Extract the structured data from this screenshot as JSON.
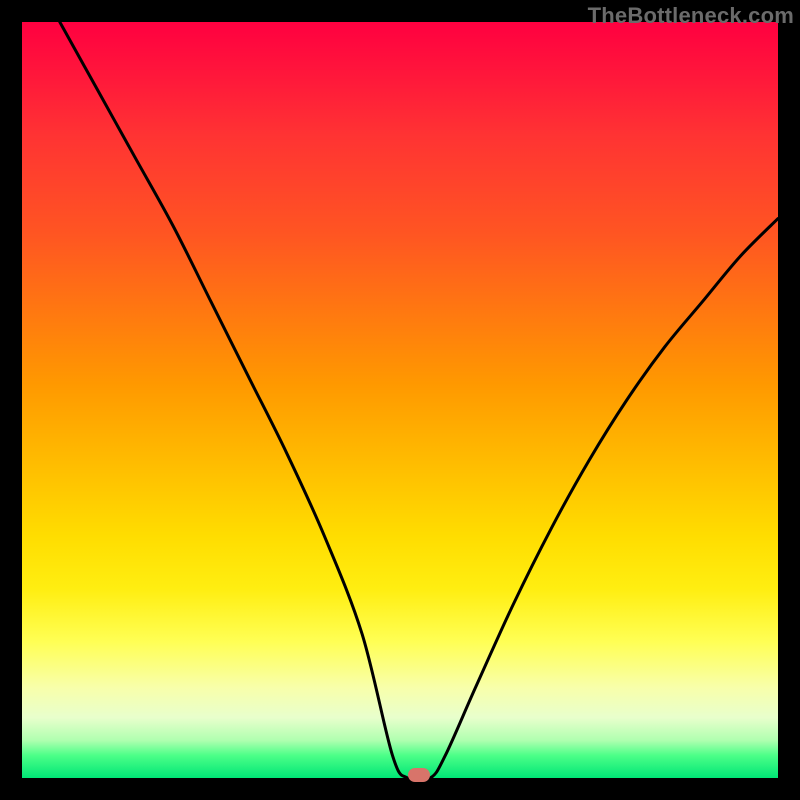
{
  "watermark": "TheBottleneck.com",
  "chart_data": {
    "type": "line",
    "title": "",
    "xlabel": "",
    "ylabel": "",
    "xlim": [
      0,
      100
    ],
    "ylim": [
      0,
      100
    ],
    "grid": false,
    "legend": false,
    "marker": {
      "x": 52.5,
      "y": 0
    },
    "series": [
      {
        "name": "curve",
        "x": [
          5,
          10,
          15,
          20,
          25,
          30,
          35,
          40,
          45,
          49,
          51,
          54,
          56,
          60,
          65,
          70,
          75,
          80,
          85,
          90,
          95,
          100
        ],
        "y": [
          100,
          91,
          82,
          73,
          63,
          53,
          43,
          32,
          19,
          3,
          0,
          0,
          3,
          12,
          23,
          33,
          42,
          50,
          57,
          63,
          69,
          74
        ]
      }
    ]
  }
}
